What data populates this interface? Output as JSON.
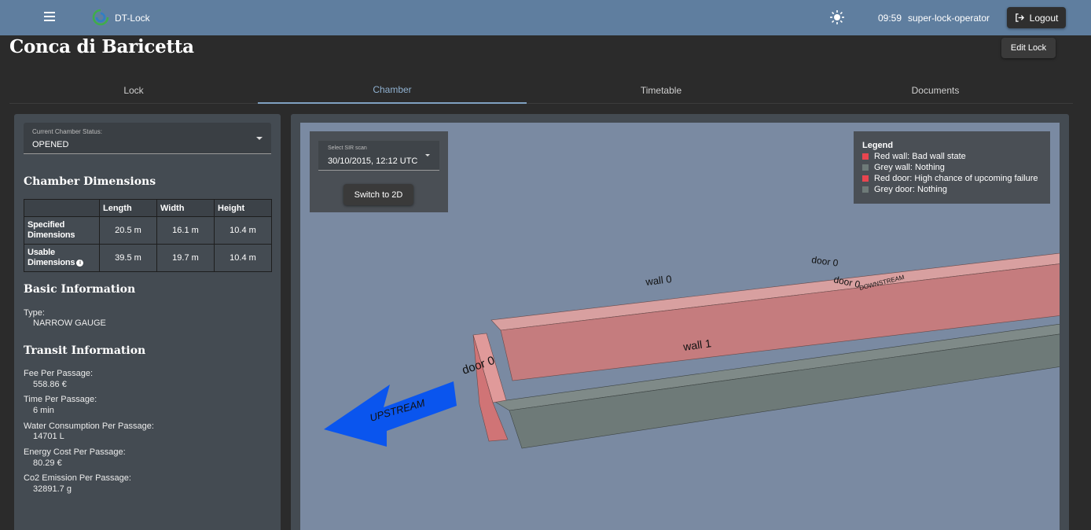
{
  "app": {
    "name": "DT-Lock",
    "time": "09:59",
    "user": "super-lock-operator",
    "logout_label": "Logout"
  },
  "page": {
    "title": "Conca di Baricetta",
    "edit_label": "Edit Lock"
  },
  "tabs": [
    {
      "label": "Lock",
      "active": false
    },
    {
      "label": "Chamber",
      "active": true
    },
    {
      "label": "Timetable",
      "active": false
    },
    {
      "label": "Documents",
      "active": false
    }
  ],
  "status": {
    "label": "Current Chamber Status:",
    "value": "OPENED"
  },
  "dimensions": {
    "heading": "Chamber Dimensions",
    "columns": [
      "Length",
      "Width",
      "Height"
    ],
    "rows": [
      {
        "label_line1": "Specified",
        "label_line2": "Dimensions",
        "values": [
          "20.5 m",
          "16.1 m",
          "10.4 m"
        ]
      },
      {
        "label_line1": "Usable",
        "label_line2": "Dimensions",
        "values": [
          "39.5 m",
          "19.7 m",
          "10.4 m"
        ]
      }
    ]
  },
  "basic": {
    "heading": "Basic Information",
    "type_label": "Type:",
    "type_value": "NARROW GAUGE"
  },
  "transit": {
    "heading": "Transit Information",
    "fields": [
      {
        "label": "Fee Per Passage:",
        "value": "558.86 €"
      },
      {
        "label": "Time Per Passage:",
        "value": "6 min"
      },
      {
        "label": "Water Consumption Per Passage:",
        "value": "14701 L"
      },
      {
        "label": "Energy Cost Per Passage:",
        "value": "80.29 €"
      },
      {
        "label": "Co2 Emission Per Passage:",
        "value": "32891.7 g"
      }
    ]
  },
  "scan": {
    "label": "Select SIR scan",
    "value": "30/10/2015, 12:12 UTC",
    "switch_label": "Switch to 2D"
  },
  "legend": {
    "title": "Legend",
    "items": [
      {
        "label": "Red wall: Bad wall state",
        "color": "#e8454f"
      },
      {
        "label": "Grey wall: Nothing",
        "color": "#6e7a78"
      },
      {
        "label": "Red door: High chance of upcoming failure",
        "color": "#e8454f"
      },
      {
        "label": "Grey door: Nothing",
        "color": "#6e7a78"
      }
    ]
  },
  "scene": {
    "wall0_label": "wall 0",
    "wall1_label": "wall 1",
    "door_upstream_label": "door 0",
    "door_downstream_label_a": "door 0",
    "door_downstream_label_b": "door 0",
    "upstream_label": "UPSTREAM",
    "downstream_label": "DOWNSTREAM",
    "colors": {
      "viewport_bg": "#7a8aa2",
      "red_wall": "#c87a7c",
      "red_door": "#d07476",
      "grey_wall": "#6e7a78",
      "arrow": "#0a55ee"
    }
  }
}
